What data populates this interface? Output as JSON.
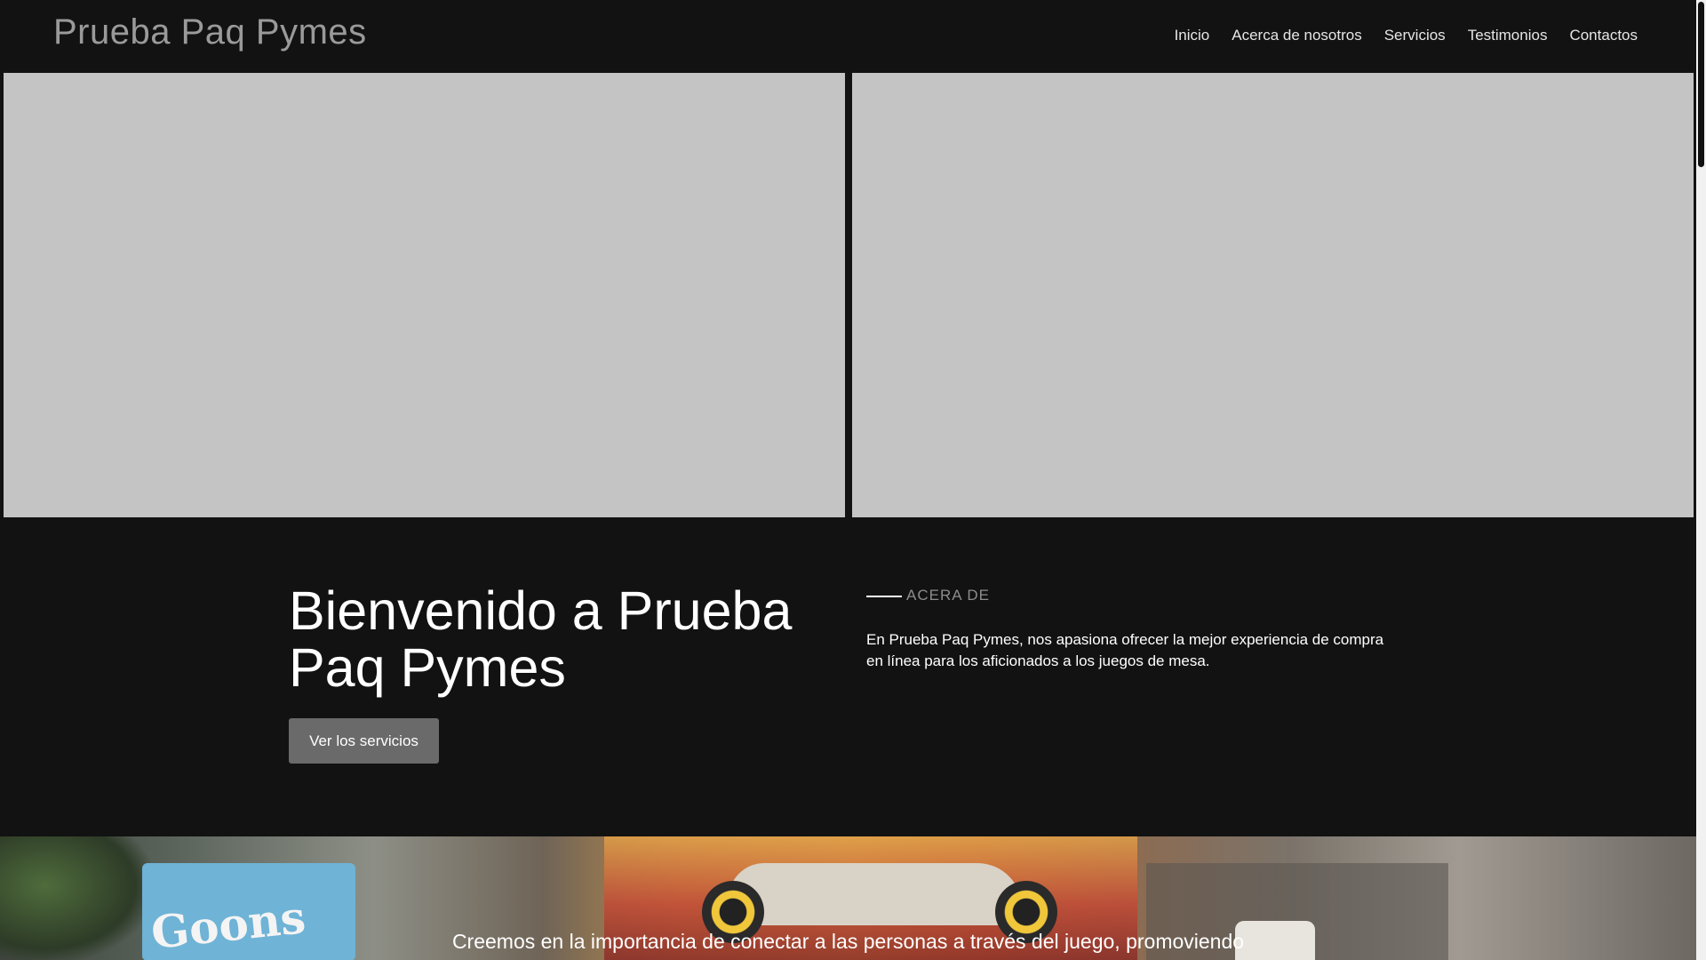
{
  "header": {
    "brand": "Prueba Paq Pymes",
    "nav": [
      "Inicio",
      "Acerca de nosotros",
      "Servicios",
      "Testimonios",
      "Contactos"
    ]
  },
  "welcome": {
    "title": "Bienvenido a Prueba Paq Pymes",
    "cta_label": "Ver los servicios"
  },
  "about": {
    "eyebrow": "ACERA DE",
    "text": "En Prueba Paq Pymes, nos apasiona ofrecer la mejor experiencia de compra en línea para los aficionados a los juegos de mesa."
  },
  "banner": {
    "text": "Creemos en la importancia de conectar a las personas a través del juego, promoviendo",
    "box_label": "Goons"
  },
  "colors": {
    "background": "#121212",
    "placeholder": "#c4c4c4",
    "button": "#6a6a6a"
  }
}
